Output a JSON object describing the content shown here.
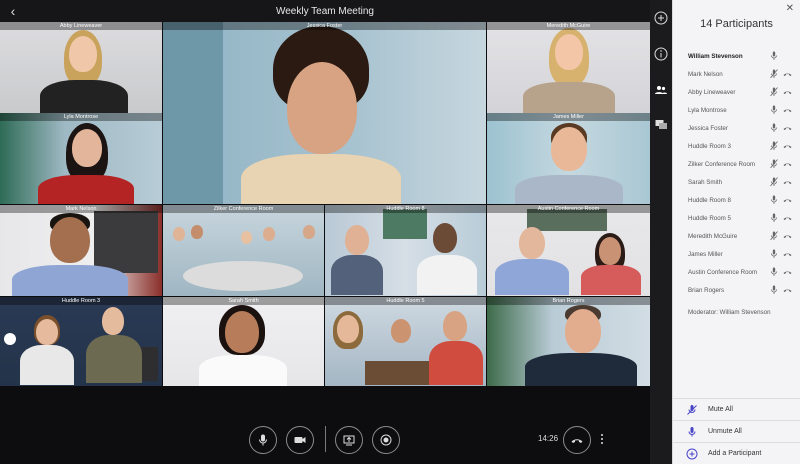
{
  "meeting": {
    "title": "Weekly Team Meeting",
    "time": "14:26"
  },
  "tiles": [
    {
      "label": "Abby Lineweaver"
    },
    {
      "label": "Jessica Foster"
    },
    {
      "label": "Meredith McGuire"
    },
    {
      "label": "Lyla Montrose"
    },
    {
      "label": "James Miller"
    },
    {
      "label": "Mark Nelson"
    },
    {
      "label": "Zilker Conference Room"
    },
    {
      "label": "Huddle Room 8"
    },
    {
      "label": "Austin Conference Room"
    },
    {
      "label": "Huddle Room 3"
    },
    {
      "label": "Sarah Smith"
    },
    {
      "label": "Huddle Room 5"
    },
    {
      "label": "Brian Rogers"
    }
  ],
  "panel": {
    "title": "14 Participants",
    "moderator": "Moderator: William Stevenson",
    "participants": [
      {
        "name": "William Stevenson",
        "muted": false,
        "host": true
      },
      {
        "name": "Mark Nelson",
        "muted": true
      },
      {
        "name": "Abby Lineweaver",
        "muted": true
      },
      {
        "name": "Lyla Montrose",
        "muted": false
      },
      {
        "name": "Jessica Foster",
        "muted": false
      },
      {
        "name": "Huddle Room 3",
        "muted": true
      },
      {
        "name": "Zilker Conference Room",
        "muted": true
      },
      {
        "name": "Sarah Smith",
        "muted": true
      },
      {
        "name": "Huddle Room 8",
        "muted": false
      },
      {
        "name": "Huddle Room 5",
        "muted": false
      },
      {
        "name": "Meredith McGuire",
        "muted": true
      },
      {
        "name": "James Miller",
        "muted": false
      },
      {
        "name": "Austin Conference Room",
        "muted": false
      },
      {
        "name": "Brian Rogers",
        "muted": false
      }
    ],
    "actions": {
      "mute_all": "Mute All",
      "unmute_all": "Unmute All",
      "add_participant": "Add a Participant"
    }
  },
  "icons": {
    "back": "chevron-left-icon",
    "add": "plus-circle-icon",
    "info": "info-icon",
    "participants": "people-icon",
    "chat": "chat-icon",
    "close": "close-icon"
  },
  "colors": {
    "accent": "#4a45c8",
    "panel_bg": "#f4f4f6",
    "stage_bg": "#0d0d0f"
  }
}
